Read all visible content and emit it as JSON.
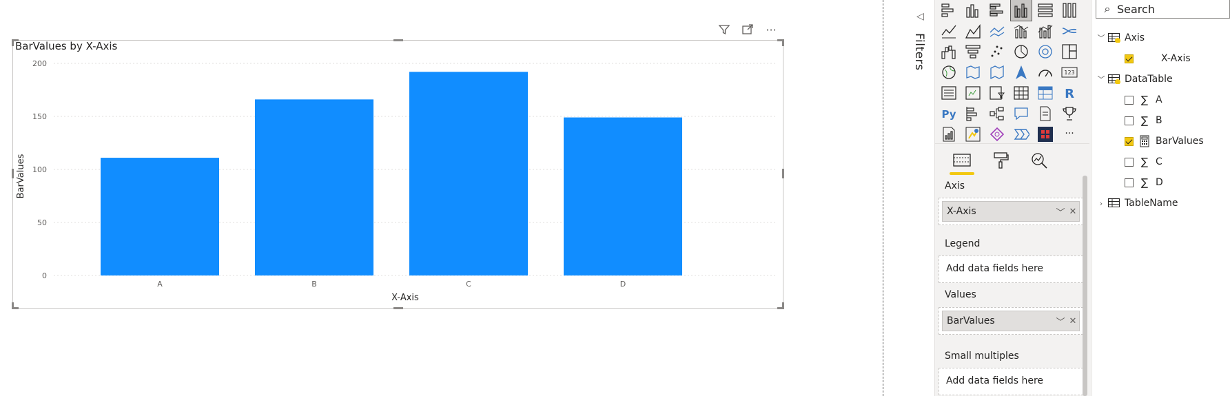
{
  "visual": {
    "title": "BarValues by X-Axis",
    "header_icons": [
      "filter-icon",
      "focus-mode-icon",
      "more-options-icon"
    ],
    "more_glyph": "···"
  },
  "chart_data": {
    "type": "bar",
    "title": "BarValues by X-Axis",
    "categories": [
      "A",
      "B",
      "C",
      "D"
    ],
    "values": [
      111,
      166,
      192,
      149
    ],
    "xlabel": "X-Axis",
    "ylabel": "BarValues",
    "ylim": [
      0,
      200
    ],
    "yticks": [
      0,
      50,
      100,
      150,
      200
    ],
    "grid": true,
    "bar_color": "#118dff"
  },
  "filters": {
    "label": "Filters"
  },
  "visualizations": {
    "icons": [
      "stacked-bar-chart-icon",
      "stacked-column-chart-icon",
      "clustered-bar-chart-icon",
      "clustered-column-chart-icon",
      "100-stacked-bar-chart-icon",
      "100-stacked-column-chart-icon",
      "line-chart-icon",
      "area-chart-icon",
      "stacked-area-chart-icon",
      "line-clustered-column-icon",
      "line-stacked-column-icon",
      "ribbon-chart-icon",
      "waterfall-chart-icon",
      "funnel-icon",
      "scatter-chart-icon",
      "pie-chart-icon",
      "donut-chart-icon",
      "treemap-icon",
      "map-icon",
      "filled-map-icon",
      "shape-map-icon",
      "azure-map-icon",
      "gauge-icon",
      "card-icon",
      "multi-row-card-icon",
      "kpi-icon",
      "slicer-icon",
      "table-icon",
      "matrix-icon",
      "r-visual-icon",
      "python-visual-icon",
      "key-influencers-icon",
      "decomposition-tree-icon",
      "qa-icon",
      "smart-narrative-icon",
      "trophy-icon",
      "paginated-report-icon",
      "power-apps-icon",
      "power-automate-icon",
      "get-more-visuals-icon",
      "custom-visual-icon",
      "more-visuals-icon"
    ],
    "selected_index": 3,
    "python_text": "Py",
    "r_text": "R",
    "card_text": "123",
    "more_text": "···",
    "tabs": [
      "fields-tab-icon",
      "format-tab-icon",
      "analytics-tab-icon"
    ],
    "wells": {
      "axis_label": "Axis",
      "axis_value": "X-Axis",
      "legend_label": "Legend",
      "legend_placeholder": "Add data fields here",
      "values_label": "Values",
      "values_value": "BarValues",
      "small_multiples_label": "Small multiples",
      "small_multiples_placeholder": "Add data fields here"
    }
  },
  "fields": {
    "search_placeholder": "Search",
    "tables": [
      {
        "name": "Axis",
        "expanded": true,
        "fields": [
          {
            "name": "X-Axis",
            "checked": true,
            "icon": ""
          }
        ]
      },
      {
        "name": "DataTable",
        "expanded": true,
        "fields": [
          {
            "name": "A",
            "checked": false,
            "icon": "∑"
          },
          {
            "name": "B",
            "checked": false,
            "icon": "∑"
          },
          {
            "name": "BarValues",
            "checked": true,
            "icon": "calculator-icon"
          },
          {
            "name": "C",
            "checked": false,
            "icon": "∑"
          },
          {
            "name": "D",
            "checked": false,
            "icon": "∑"
          }
        ]
      },
      {
        "name": "TableName",
        "expanded": false,
        "fields": []
      }
    ]
  },
  "colors": {
    "accent_yellow": "#f2c811",
    "bar_blue": "#118dff"
  }
}
